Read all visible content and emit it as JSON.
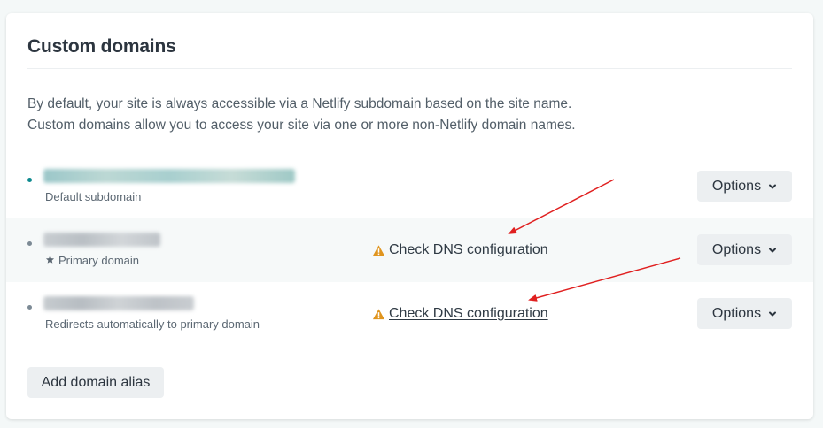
{
  "section": {
    "title": "Custom domains",
    "description_line_1": "By default, your site is always accessible via a Netlify subdomain based on the site name.",
    "description_line_2": "Custom domains allow you to access your site via one or more non-Netlify domain names."
  },
  "domains": [
    {
      "name_redacted": true,
      "subtext": "Default subdomain",
      "options_label": "Options",
      "bullet_color": "#0e8a8f"
    },
    {
      "name_redacted": true,
      "subtext": "Primary domain",
      "subtext_icon": "star-icon",
      "warning_icon": "warning-triangle-icon",
      "dns_link": "Check DNS configuration",
      "options_label": "Options",
      "bullet_color": "#7c8a95"
    },
    {
      "name_redacted": true,
      "subtext": "Redirects automatically to primary domain",
      "warning_icon": "warning-triangle-icon",
      "dns_link": "Check DNS configuration",
      "options_label": "Options",
      "bullet_color": "#7c8a95"
    }
  ],
  "add_alias_label": "Add domain alias",
  "colors": {
    "warning": "#e0951f",
    "annotation_arrow": "#e02020",
    "button_bg": "#eceff1",
    "row_stripe": "#f6f9f9"
  }
}
